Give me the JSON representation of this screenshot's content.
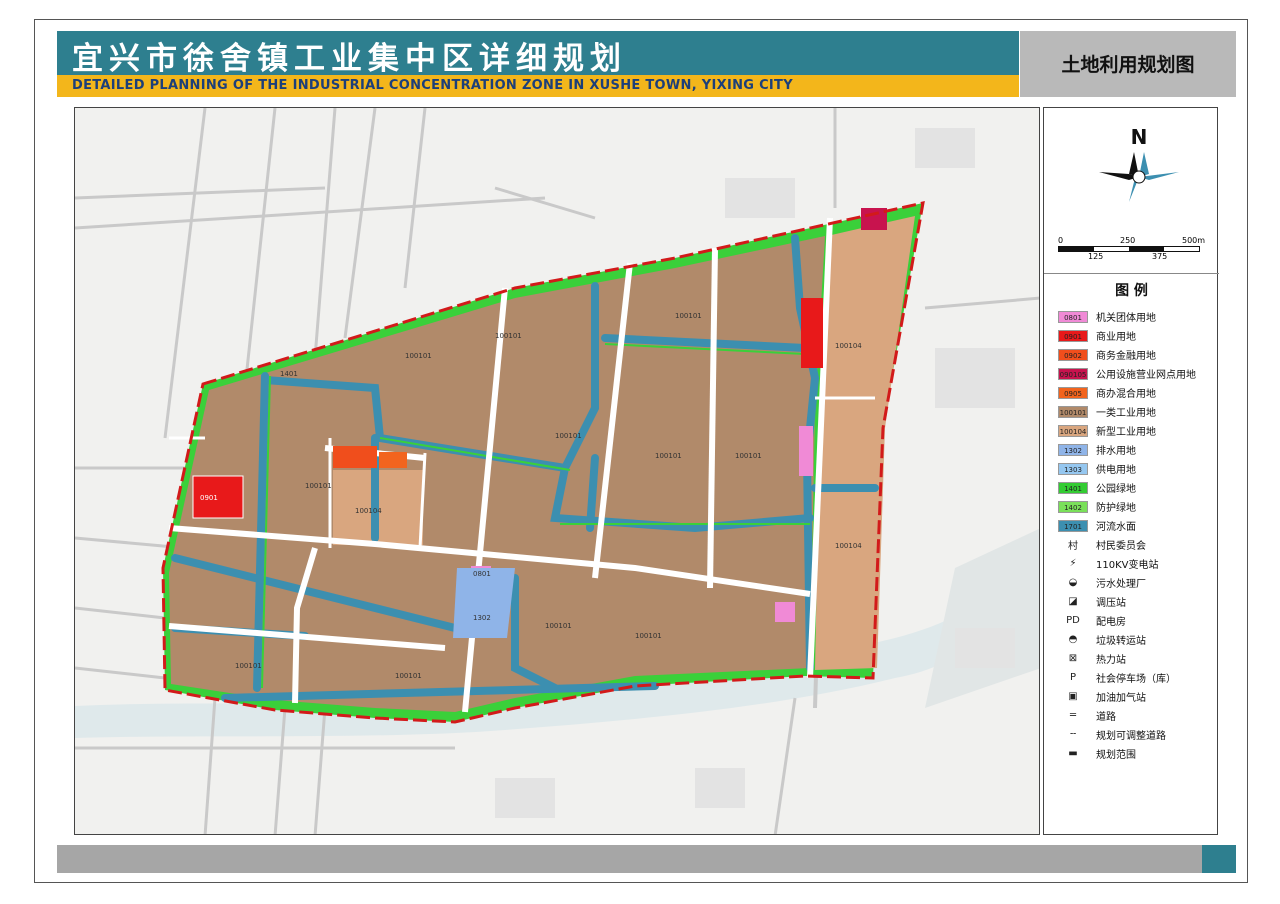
{
  "header": {
    "title_cn": "宜兴市徐舍镇工业集中区详细规划",
    "title_en": "DETAILED PLANNING OF THE INDUSTRIAL CONCENTRATION ZONE IN XUSHE TOWN, YIXING CITY",
    "sheet_title": "土地利用规划图"
  },
  "compass": {
    "north_label": "N"
  },
  "scale_bar": {
    "top_labels": [
      "0",
      "250",
      "500m"
    ],
    "bottom_labels": [
      "125",
      "375"
    ]
  },
  "legend": {
    "title": "图 例",
    "items": [
      {
        "code": "0801",
        "label": "机关团体用地",
        "color": "#f08ad6"
      },
      {
        "code": "0901",
        "label": "商业用地",
        "color": "#e8191a"
      },
      {
        "code": "0902",
        "label": "商务金融用地",
        "color": "#f04e1c"
      },
      {
        "code": "090105",
        "label": "公用设施营业网点用地",
        "color": "#c8134e"
      },
      {
        "code": "0905",
        "label": "商办混合用地",
        "color": "#f2641e"
      },
      {
        "code": "100101",
        "label": "一类工业用地",
        "color": "#b18a6a"
      },
      {
        "code": "100104",
        "label": "新型工业用地",
        "color": "#d9a67f"
      },
      {
        "code": "1302",
        "label": "排水用地",
        "color": "#8fb4e8"
      },
      {
        "code": "1303",
        "label": "供电用地",
        "color": "#95c7f0"
      },
      {
        "code": "1401",
        "label": "公园绿地",
        "color": "#33cc33"
      },
      {
        "code": "1402",
        "label": "防护绿地",
        "color": "#7ae05a"
      },
      {
        "code": "1701",
        "label": "河流水面",
        "color": "#3c8fb0"
      }
    ],
    "symbols": [
      {
        "symbol": "村",
        "label": "村民委员会"
      },
      {
        "symbol": "⚡",
        "label": "110KV变电站"
      },
      {
        "symbol": "◒",
        "label": "污水处理厂"
      },
      {
        "symbol": "◪",
        "label": "调压站"
      },
      {
        "symbol": "PD",
        "label": "配电房"
      },
      {
        "symbol": "◓",
        "label": "垃圾转运站"
      },
      {
        "symbol": "⊠",
        "label": "热力站"
      },
      {
        "symbol": "P",
        "label": "社会停车场（库）"
      },
      {
        "symbol": "▣",
        "label": "加油加气站"
      },
      {
        "symbol": "═",
        "label": "道路"
      },
      {
        "symbol": "╌",
        "label": "规划可调整道路"
      },
      {
        "symbol": "▬",
        "label": "规划范围"
      }
    ]
  },
  "map_labels": {
    "site_100101": "100101",
    "site_100104": "100104",
    "site_1302": "1302",
    "site_0801": "0801",
    "site_0901": "0901",
    "site_1401": "1401"
  }
}
